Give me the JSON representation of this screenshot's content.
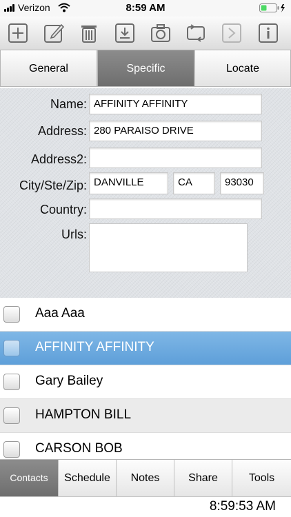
{
  "status_bar": {
    "carrier": "Verizon",
    "time": "8:59 AM"
  },
  "toolbar": {
    "icons": [
      "add-icon",
      "edit-icon",
      "trash-icon",
      "download-icon",
      "camera-icon",
      "sync-icon",
      "forward-icon",
      "info-icon"
    ]
  },
  "segments": [
    {
      "label": "General",
      "active": false
    },
    {
      "label": "Specific",
      "active": true
    },
    {
      "label": "Locate",
      "active": false
    }
  ],
  "form": {
    "name_label": "Name:",
    "name_value": "AFFINITY AFFINITY",
    "address_label": "Address:",
    "address_value": "280 PARAISO DRIVE",
    "address2_label": "Address2:",
    "address2_value": "",
    "city_label": "City/Ste/Zip:",
    "city_value": "DANVILLE",
    "state_value": "CA",
    "zip_value": "93030",
    "country_label": "Country:",
    "country_value": "",
    "urls_label": "Urls:",
    "urls_value": ""
  },
  "contacts": [
    {
      "name": "Aaa Aaa",
      "selected": false
    },
    {
      "name": "AFFINITY AFFINITY",
      "selected": true
    },
    {
      "name": "Gary Bailey",
      "selected": false
    },
    {
      "name": "HAMPTON BILL",
      "selected": false
    },
    {
      "name": "CARSON BOB",
      "selected": false
    }
  ],
  "bottom_tabs": [
    {
      "label": "Contacts",
      "active": true
    },
    {
      "label": "Schedule",
      "active": false
    },
    {
      "label": "Notes",
      "active": false
    },
    {
      "label": "Share",
      "active": false
    },
    {
      "label": "Tools",
      "active": false
    }
  ],
  "footer": {
    "clock": "8:59:53 AM"
  },
  "colors": {
    "selection": "#6aa8dd",
    "active_tab": "#7d7d7d",
    "battery": "#4cd964"
  }
}
